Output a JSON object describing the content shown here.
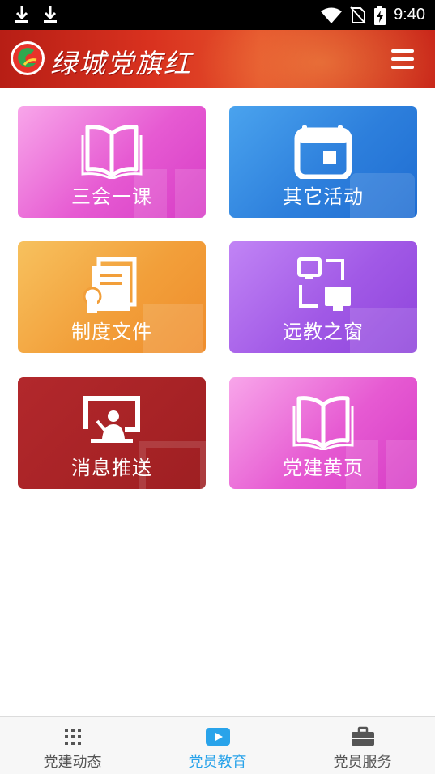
{
  "status_bar": {
    "time": "9:40"
  },
  "header": {
    "brand": "绿城党旗红"
  },
  "tiles": [
    {
      "label": "三会一课"
    },
    {
      "label": "其它活动"
    },
    {
      "label": "制度文件"
    },
    {
      "label": "远教之窗"
    },
    {
      "label": "消息推送"
    },
    {
      "label": "党建黄页"
    }
  ],
  "bottom_nav": {
    "active_color": "#29a3ea",
    "items": [
      {
        "label": "党建动态",
        "icon": "grid-icon"
      },
      {
        "label": "党员教育",
        "icon": "play-icon",
        "active": true
      },
      {
        "label": "党员服务",
        "icon": "briefcase-icon"
      }
    ]
  }
}
